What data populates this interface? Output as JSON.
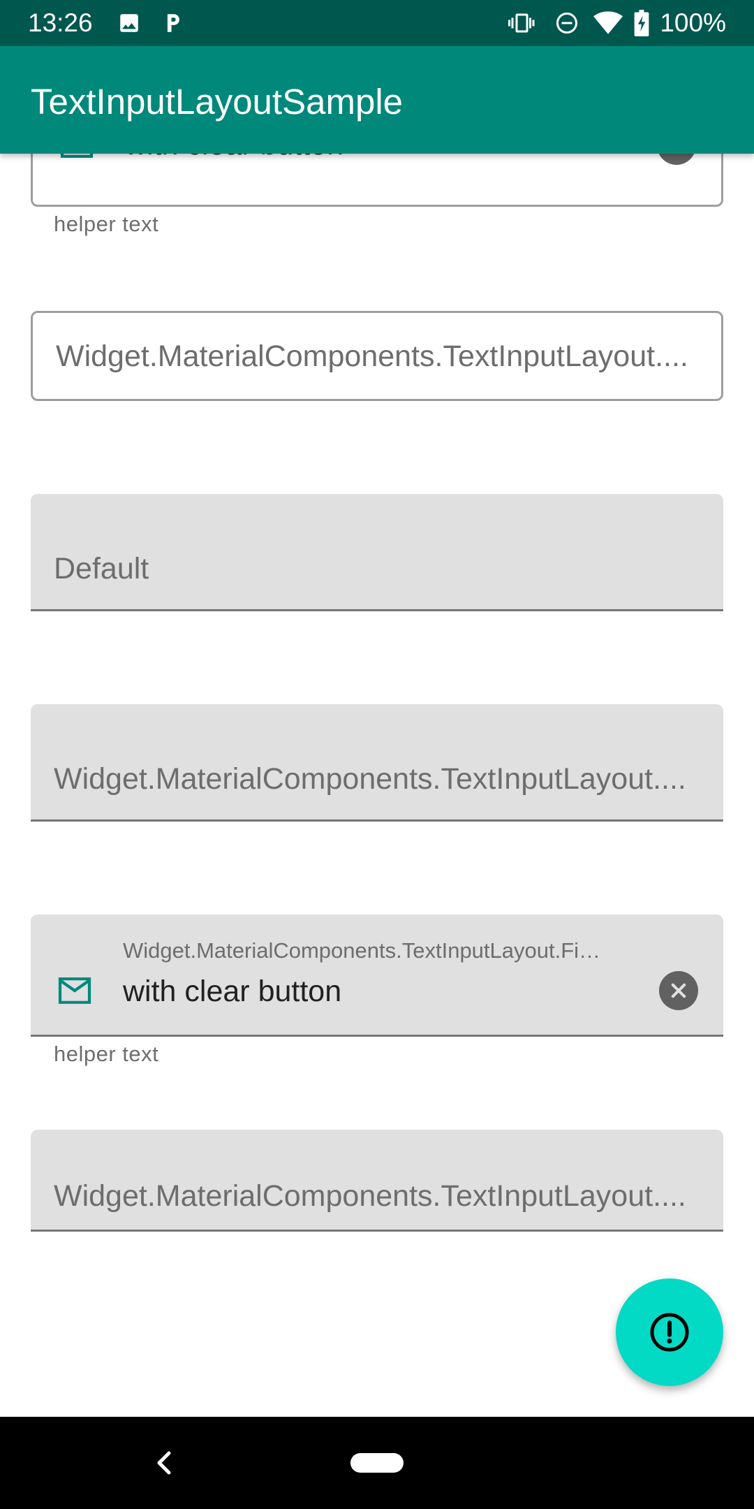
{
  "status_bar": {
    "time": "13:26",
    "battery": "100%",
    "icons": [
      "image-icon",
      "parking-icon",
      "vibrate-icon",
      "do-not-disturb-icon",
      "wifi-icon",
      "battery-charging-icon"
    ]
  },
  "app_bar": {
    "title": "TextInputLayoutSample",
    "color": "#00897b",
    "status_color": "#00574e"
  },
  "fields": {
    "top_partial": {
      "value": "with clear button",
      "helper": "helper text",
      "icon": "mail-icon",
      "end_icon": "clear-icon"
    },
    "outlined_style": {
      "hint": "Widget.MaterialComponents.TextInputLayout...."
    },
    "filled_default": {
      "hint": "Default"
    },
    "filled_style": {
      "hint": "Widget.MaterialComponents.TextInputLayout...."
    },
    "filled_clear": {
      "label": "Widget.MaterialComponents.TextInputLayout.Fi…",
      "value": "with clear button",
      "helper": "helper text",
      "icon": "mail-icon",
      "end_icon": "clear-icon"
    },
    "filled_last": {
      "hint": "Widget.MaterialComponents.TextInputLayout...."
    }
  },
  "fab": {
    "icon": "alert-icon",
    "color": "#03dac5"
  },
  "accent_color": "#00897b"
}
